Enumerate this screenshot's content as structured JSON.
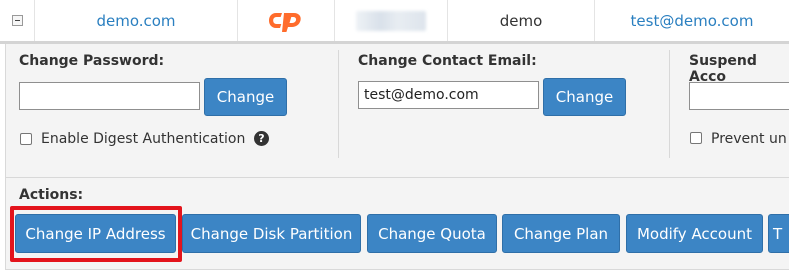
{
  "account_row": {
    "domain": "demo.com",
    "username": "demo",
    "email": "test@demo.com"
  },
  "change_password": {
    "label": "Change Password:",
    "value": "",
    "button": "Change",
    "digest_label": "Enable Digest Authentication",
    "digest_checked": false
  },
  "change_email": {
    "label": "Change Contact Email:",
    "value": "test@demo.com",
    "button": "Change"
  },
  "suspend": {
    "label": "Suspend Acco",
    "value": "",
    "prevent_label": "Prevent un"
  },
  "actions": {
    "label": "Actions:",
    "buttons": [
      "Change IP Address",
      "Change Disk Partition",
      "Change Quota",
      "Change Plan",
      "Modify Account",
      "T"
    ]
  },
  "colors": {
    "button_blue": "#3c85c5",
    "link_blue": "#2a7fc0",
    "highlight_red": "#e3141c",
    "cpanel_orange": "#ff6c2c"
  },
  "icons": {
    "collapse": "minus-square-icon",
    "cpanel": "cpanel-logo-icon",
    "help": "question-circle-icon"
  }
}
